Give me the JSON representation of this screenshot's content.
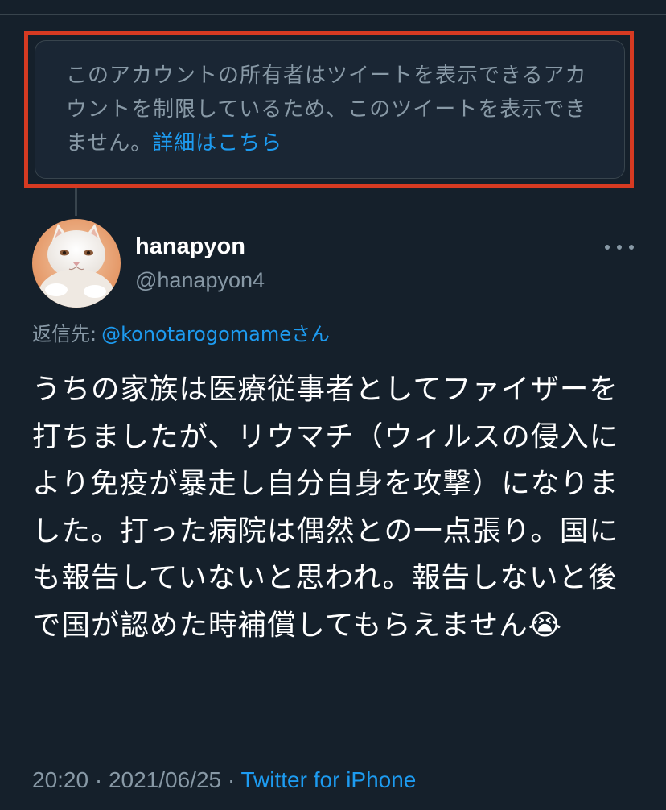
{
  "notice": {
    "text": "このアカウントの所有者はツイートを表示できるアカウントを制限しているため、このツイートを表示できません。",
    "link_label": "詳細はこちら",
    "highlight_color": "#d63a22"
  },
  "tweet": {
    "author": {
      "display_name": "hanapyon",
      "handle": "@hanapyon4"
    },
    "reply_prefix": "返信先:",
    "reply_to": "@konotarogomameさん",
    "text": "うちの家族は医療従事者としてファイザーを打ちましたが、リウマチ（ウィルスの侵入により免疫が暴走し自分自身を攻撃）になりました。打った病院は偶然との一点張り。国にも報告していないと思われ。報告しないと後で国が認めた時補償してもらえません😭",
    "time": "20:20",
    "separator": "·",
    "date": "2021/06/25",
    "source": "Twitter for iPhone"
  },
  "icons": {
    "more": "more-horizontal-icon",
    "emoji": "loudly-crying-face"
  },
  "colors": {
    "background": "#15202b",
    "secondary_text": "#8899a6",
    "link": "#1d9bf0"
  }
}
